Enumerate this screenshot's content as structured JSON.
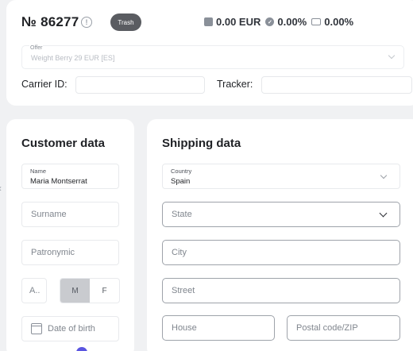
{
  "header": {
    "order_number": "№ 86277",
    "info_icon": "info-icon",
    "status_badge": "Trash",
    "stats": {
      "revenue": "0.00 EUR",
      "approval_rate": "0.00%",
      "cash_rate": "0.00%"
    }
  },
  "offer": {
    "label": "Offer",
    "value": "Weight Berry 29 EUR [ES]"
  },
  "carrier": {
    "carrier_label": "Carrier ID:",
    "tracker_label": "Tracker:"
  },
  "customer": {
    "title": "Customer data",
    "name_label": "Name",
    "name_value": "Maria Montserrat",
    "surname_placeholder": "Surname",
    "patronymic_placeholder": "Patronymic",
    "age_placeholder": "A..",
    "gender_options": [
      "M",
      "F"
    ],
    "gender_selected": "M",
    "dob_placeholder": "Date of birth"
  },
  "shipping": {
    "title": "Shipping data",
    "country_label": "Country",
    "country_value": "Spain",
    "state_placeholder": "State",
    "city_placeholder": "City",
    "street_placeholder": "Street",
    "house_placeholder": "House",
    "postal_placeholder": "Postal code/ZIP"
  },
  "icons": {
    "wallet": "wallet-icon",
    "check": "check-circle-icon",
    "cash": "cash-icon",
    "calendar": "calendar-icon"
  },
  "colors": {
    "badge_bg": "#5a5c61",
    "accent": "#5a55e0",
    "page_bg": "#f0f1f3"
  }
}
